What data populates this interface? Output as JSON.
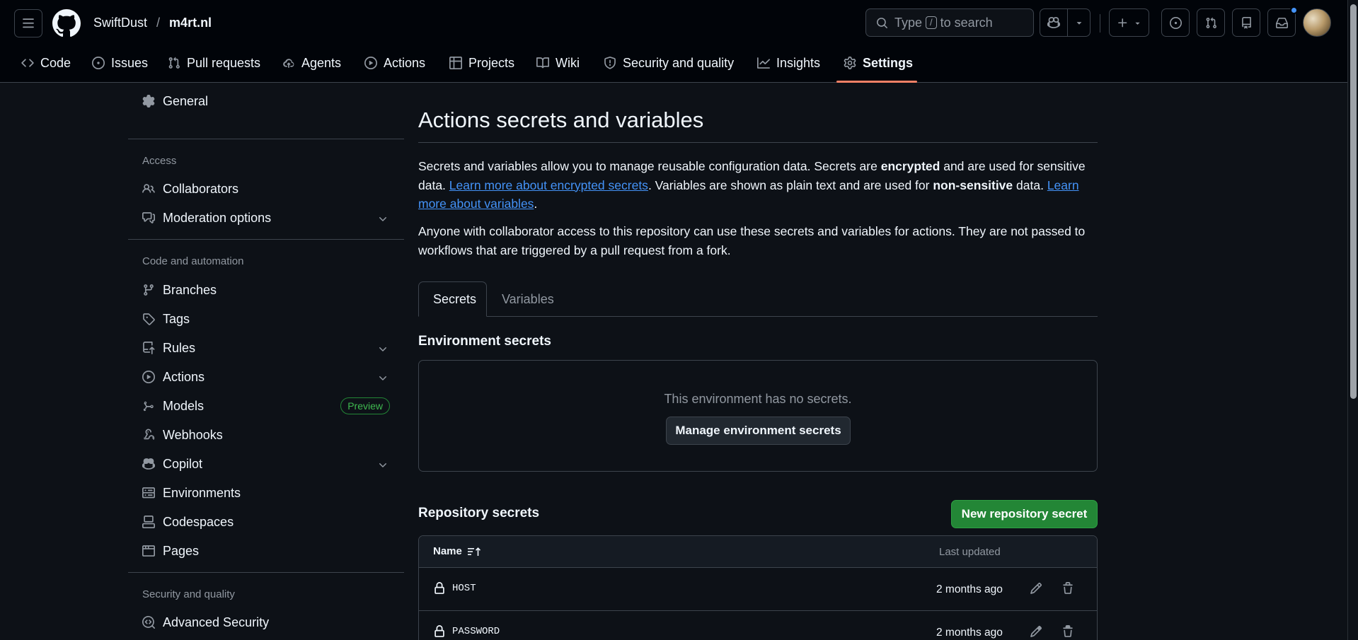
{
  "header": {
    "owner": "SwiftDust",
    "separator": "/",
    "repo": "m4rt.nl",
    "search": {
      "before": "Type",
      "key": "/",
      "after": "to search"
    }
  },
  "repo_nav": {
    "tabs": [
      {
        "label": "Code",
        "icon": "code-icon"
      },
      {
        "label": "Issues",
        "icon": "issue-icon"
      },
      {
        "label": "Pull requests",
        "icon": "pull-request-icon"
      },
      {
        "label": "Agents",
        "icon": "agent-icon"
      },
      {
        "label": "Actions",
        "icon": "play-icon"
      },
      {
        "label": "Projects",
        "icon": "table-icon"
      },
      {
        "label": "Wiki",
        "icon": "book-icon"
      },
      {
        "label": "Security and quality",
        "icon": "shield-icon"
      },
      {
        "label": "Insights",
        "icon": "graph-icon"
      },
      {
        "label": "Settings",
        "icon": "gear-icon",
        "selected": true
      }
    ]
  },
  "sidebar": {
    "general": "General",
    "access_heading": "Access",
    "collaborators": "Collaborators",
    "moderation": "Moderation options",
    "code_heading": "Code and automation",
    "branches": "Branches",
    "tags": "Tags",
    "rules": "Rules",
    "actions": "Actions",
    "models": "Models",
    "preview_badge": "Preview",
    "webhooks": "Webhooks",
    "copilot": "Copilot",
    "environments": "Environments",
    "codespaces": "Codespaces",
    "pages": "Pages",
    "security_heading": "Security and quality",
    "advanced_security": "Advanced Security"
  },
  "main": {
    "title": "Actions secrets and variables",
    "intro": {
      "p1": "Secrets and variables allow you to manage reusable configuration data. Secrets are ",
      "encrypted": "encrypted",
      "p2": " and are used for sensitive data. ",
      "link1": "Learn more about encrypted secrets",
      "p3": ". Variables are shown as plain text and are used for ",
      "nonsensitive": "non-sensitive",
      "p4": " data. ",
      "link2": "Learn more about variables",
      "p5": "."
    },
    "note": "Anyone with collaborator access to this repository can use these secrets and variables for actions. They are not passed to workflows that are triggered by a pull request from a fork.",
    "tabs": {
      "secrets": "Secrets",
      "variables": "Variables"
    },
    "env_secrets": {
      "heading": "Environment secrets",
      "empty": "This environment has no secrets.",
      "button": "Manage environment secrets"
    },
    "repo_secrets": {
      "heading": "Repository secrets",
      "new_button": "New repository secret",
      "col_name": "Name",
      "col_updated": "Last updated",
      "rows": [
        {
          "name": "HOST",
          "updated": "2 months ago"
        },
        {
          "name": "PASSWORD",
          "updated": "2 months ago"
        }
      ]
    }
  },
  "colors": {
    "bg": "#0d1117",
    "header_bg": "#010409",
    "border": "#3d444d",
    "accent_underline": "#f78166",
    "link": "#4493f8",
    "primary_button": "#238636"
  }
}
